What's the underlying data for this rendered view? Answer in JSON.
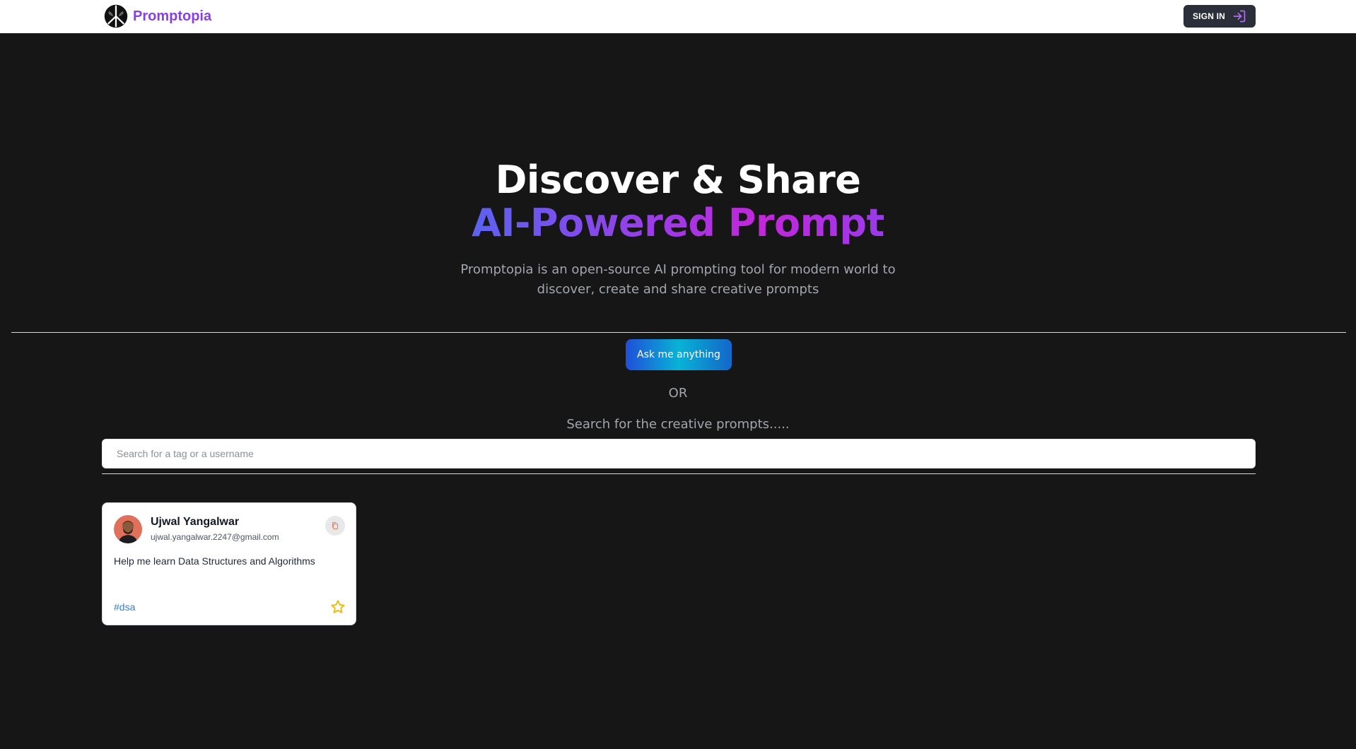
{
  "navbar": {
    "brand_name": "Promptopia",
    "logo_icon": "peace-leaf-logo-icon",
    "signin_label": "SIGN IN",
    "signin_icon": "sign-in-arrow-icon"
  },
  "hero": {
    "title_line1": "Discover & Share",
    "title_line2": "AI-Powered Prompt",
    "subtitle": "Promptopia is an open-source AI prompting tool for modern world to discover, create and share creative prompts"
  },
  "ask_button_label": "Ask me anything",
  "or_text": "OR",
  "search": {
    "caption": "Search for the creative prompts.....",
    "placeholder": "Search for a tag or a username",
    "value": ""
  },
  "prompts": [
    {
      "username": "Ujwal Yangalwar",
      "email": "ujwal.yangalwar.2247@gmail.com",
      "prompt": "Help me learn Data Structures and Algorithms",
      "tag": "#dsa",
      "copy_icon": "copy-icon",
      "favorite_icon": "star-outline-icon"
    }
  ],
  "colors": {
    "background": "#161617",
    "brand": "#8a3ee8",
    "gradient_start": "#5b63f0",
    "gradient_end": "#c227d9",
    "tag": "#2f7de1",
    "star": "#f5b400"
  }
}
